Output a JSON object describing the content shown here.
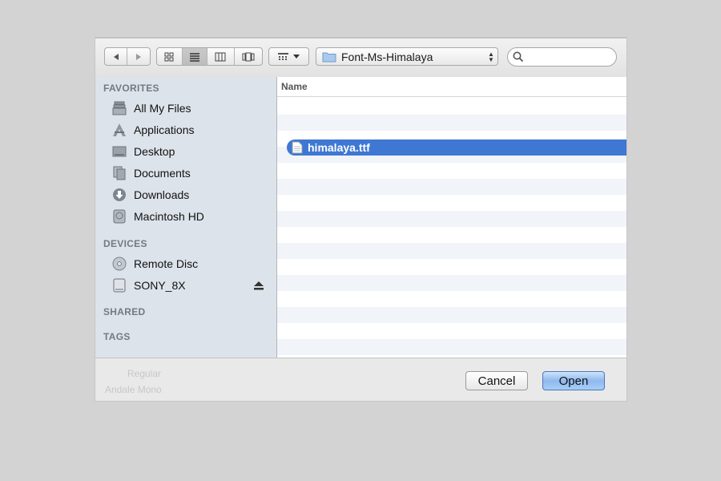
{
  "toolbar": {
    "back_icon": "back-arrow-icon",
    "forward_icon": "forward-arrow-icon",
    "view_modes": [
      "icon-view",
      "list-view",
      "column-view",
      "coverflow-view"
    ],
    "active_view": "list-view",
    "arrange_icon": "grid-arrange-icon",
    "location": "Font-Ms-Himalaya",
    "search": {
      "value": "",
      "placeholder": ""
    }
  },
  "sidebar": {
    "sections": {
      "favorites": "FAVORITES",
      "devices": "DEVICES",
      "shared": "SHARED",
      "tags": "TAGS"
    },
    "favorites": [
      {
        "label": "All My Files",
        "icon": "all-files-icon"
      },
      {
        "label": "Applications",
        "icon": "applications-icon"
      },
      {
        "label": "Desktop",
        "icon": "desktop-icon"
      },
      {
        "label": "Documents",
        "icon": "documents-icon"
      },
      {
        "label": "Downloads",
        "icon": "downloads-icon"
      },
      {
        "label": "Macintosh HD",
        "icon": "hard-drive-icon"
      }
    ],
    "devices": [
      {
        "label": "Remote Disc",
        "icon": "remote-disc-icon"
      },
      {
        "label": "SONY_8X",
        "icon": "external-drive-icon",
        "ejectable": true
      }
    ]
  },
  "file_list": {
    "column_header": "Name",
    "files": [
      {
        "name": "himalaya.ttf",
        "icon": "document-icon",
        "selected": true
      }
    ]
  },
  "footer": {
    "cancel_label": "Cancel",
    "open_label": "Open",
    "ghost_text": [
      "Regular",
      "Andale Mono"
    ]
  },
  "colors": {
    "selection": "#3e78d2",
    "sidebar_bg": "#dde3ea",
    "section_header": "#707a85"
  }
}
